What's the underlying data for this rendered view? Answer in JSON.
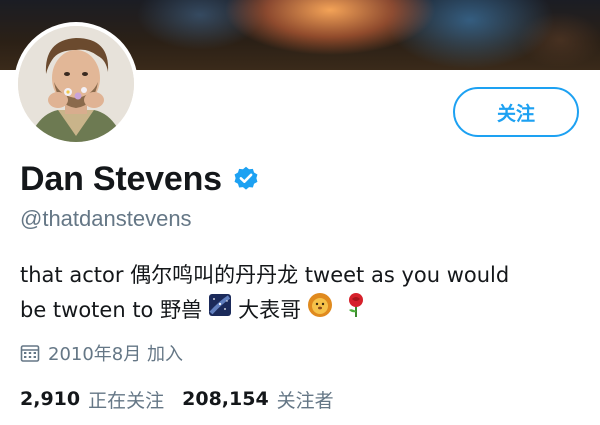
{
  "profile": {
    "name": "Dan Stevens",
    "handle": "@thatdanstevens",
    "follow_label": "关注",
    "bio_line1_text": "that actor 偶尔鸣叫的丹丹龙 tweet as you would",
    "bio_line2_a": "be twoten to 野兽",
    "bio_line2_b": "大表哥",
    "joined": "2010年8月 加入",
    "following_count": "2,910",
    "following_label": "正在关注",
    "followers_count": "208,154",
    "followers_label": "关注者"
  },
  "icons": {
    "verified": "verified-badge-icon",
    "calendar": "calendar-icon",
    "night_sky_emoji": "milky-way-emoji",
    "lion_emoji": "lion-face-emoji",
    "rose_emoji": "rose-emoji"
  },
  "colors": {
    "accent": "#1da1f2",
    "text": "#14171a",
    "secondary": "#657786"
  }
}
